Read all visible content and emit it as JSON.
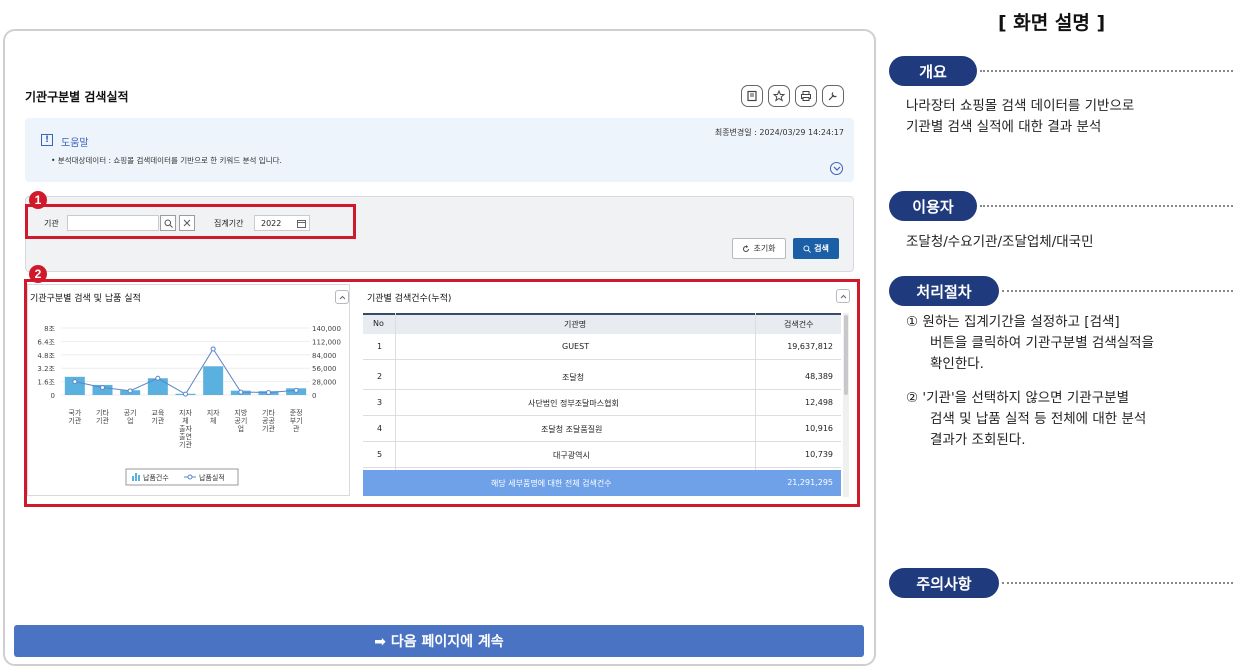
{
  "page": {
    "title": "기관구분별 검색실적",
    "updated": "최종변경일 : 2024/03/29 14:24:17",
    "help_title": "도움말",
    "help_desc": "• 분석대상데이터 : 쇼핑몰 검색데이터를 기반으로 한 키워드 분석 입니다.",
    "next_button": "➡ 다음 페이지에 계속"
  },
  "toolbar": {
    "icons": [
      "manual-icon",
      "star-icon",
      "print-icon",
      "settings-icon"
    ]
  },
  "search": {
    "org_label": "기관",
    "org_value": "",
    "period_label": "집계기간",
    "year_value": "2022",
    "reset_label": "초기화",
    "search_label": "검색"
  },
  "badges": [
    "1",
    "2"
  ],
  "chart_panel": {
    "title": "기관구분별 검색 및 납품 실적"
  },
  "chart_data": {
    "type": "bar",
    "categories": [
      "국가기관",
      "기타기관",
      "공기업",
      "교육기관",
      "자치체출자출연기관",
      "지자체",
      "지방공기업",
      "기타공공기관",
      "준정부기관"
    ],
    "category_lines": [
      [
        "국가",
        "기관"
      ],
      [
        "기타",
        "기관"
      ],
      [
        "공기",
        "업"
      ],
      [
        "교육",
        "기관"
      ],
      [
        "지자",
        "체",
        "출자",
        "출연",
        "기관"
      ],
      [
        "지자",
        "체"
      ],
      [
        "지방",
        "공기",
        "업"
      ],
      [
        "기타",
        "공공",
        "기관"
      ],
      [
        "준정",
        "부기",
        "관"
      ]
    ],
    "series": [
      {
        "name": "납품건수",
        "type": "bar",
        "axis": "right",
        "values": [
          38000,
          21000,
          10000,
          35000,
          2500,
          60000,
          9000,
          8000,
          14000
        ]
      },
      {
        "name": "납품실적",
        "type": "line",
        "axis": "left",
        "values": [
          1.6,
          0.9,
          0.5,
          2.0,
          0.1,
          5.5,
          0.35,
          0.3,
          0.55
        ]
      }
    ],
    "left_axis": {
      "ticks": [
        "8조",
        "6.4조",
        "4.8조",
        "3.2조",
        "1.6조",
        "0"
      ],
      "ylim": [
        0,
        8
      ]
    },
    "right_axis": {
      "ticks": [
        "140,000",
        "112,000",
        "84,000",
        "56,000",
        "28,000",
        "0"
      ],
      "ylim": [
        0,
        140000
      ]
    },
    "legend": [
      "납품건수",
      "납품실적"
    ],
    "colors": {
      "bar": "#5ab0df",
      "line": "#5a86c8"
    }
  },
  "table_panel": {
    "title": "기관별 검색건수(누적)",
    "headers": [
      "No",
      "기관명",
      "검색건수"
    ],
    "rows": [
      {
        "no": "1",
        "name": "GUEST",
        "count": "19,637,812"
      },
      {
        "no": "2",
        "name": "조달청",
        "count": "48,389"
      },
      {
        "no": "3",
        "name": "사단법인 정부조달마스협회",
        "count": "12,498"
      },
      {
        "no": "4",
        "name": "조달청 조달품질원",
        "count": "10,916"
      },
      {
        "no": "5",
        "name": "대구광역시",
        "count": "10,739"
      }
    ],
    "total_label": "해당 세부품명에 대한 전체 검색건수",
    "total_value": "21,291,295"
  },
  "side": {
    "title": "[ 화면 설명 ]",
    "overview_label": "개요",
    "overview_text": [
      "나라장터 쇼핑몰 검색 데이터를 기반으로",
      "기관별 검색 실적에 대한 결과 분석"
    ],
    "user_label": "이용자",
    "user_text": "조달청/수요기관/조달업체/대국민",
    "proc_label": "처리절차",
    "proc_1": [
      "① 원하는 집계기간을 설정하고 [검색]",
      "버튼을 클릭하여 기관구분별 검색실적을",
      "확인한다."
    ],
    "proc_2": [
      "② '기관'을 선택하지 않으면 기관구분별",
      "검색 및 납품 실적 등 전체에 대한 분석",
      "결과가 조회된다."
    ],
    "caution_label": "주의사항"
  },
  "colors": {
    "accent": "#1b5fa6",
    "highlight": "#d01a2b",
    "pill": "#1f3a7d",
    "total_row": "#6fa1e8"
  }
}
